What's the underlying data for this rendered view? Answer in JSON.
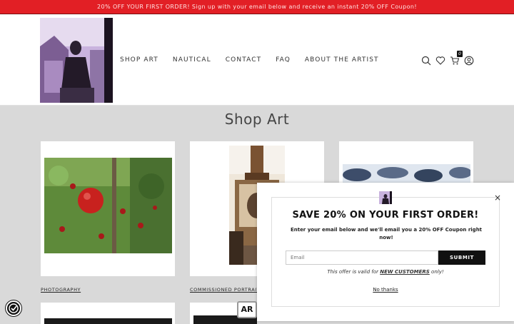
{
  "announcement": "20% OFF YOUR FIRST ORDER! Sign up with your email below and receive an instant 20% OFF Coupon!",
  "nav": {
    "items": [
      "SHOP ART",
      "NAUTICAL",
      "CONTACT",
      "FAQ",
      "ABOUT THE ARTIST"
    ]
  },
  "header_icons": {
    "search": "search-icon",
    "wishlist": "heart-icon",
    "cart": "cart-icon",
    "cart_count": "0",
    "account": "user-icon"
  },
  "section_title": "Shop Art",
  "cards": [
    {
      "caption": "PHOTOGRAPHY"
    },
    {
      "caption": "COMMISSIONED PORTRAIT"
    }
  ],
  "popup": {
    "heading": "SAVE 20% ON YOUR FIRST ORDER!",
    "subtext": "Enter your email below and we'll email you a 20% OFF Coupon right now!",
    "email_placeholder": "Email",
    "submit_label": "SUBMIT",
    "offer_prefix": "This offer is valid for ",
    "offer_emphasis": "NEW CUSTOMERS",
    "offer_suffix": " only!",
    "dismiss": "No thanks",
    "close": "×"
  },
  "colors": {
    "announcement_bg": "#e21f25",
    "submit_bg": "#111111",
    "page_bg": "#d9d9d9"
  }
}
